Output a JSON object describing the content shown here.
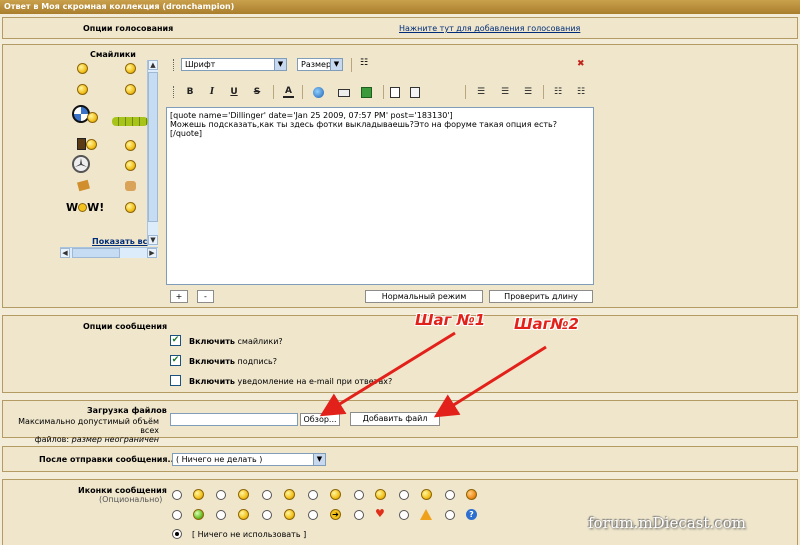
{
  "title": "Ответ в Моя скромная коллекция (dronchampion)",
  "poll": {
    "label": "Опции голосования",
    "link": "Нажните тут для добавления голосования"
  },
  "smilies": {
    "label": "Смайлики",
    "show_all": "Показать вс",
    "items": [
      "smile",
      "sad",
      "grin",
      "cool",
      "bmw",
      "wave",
      "caterpillar",
      "mercedes",
      "laugh",
      "beer",
      "shocked",
      "mercedes-star",
      "thumbsup",
      "cards",
      "thumb",
      "wow",
      "happy"
    ],
    "wow_text": "W",
    "wow_text2": "W!"
  },
  "editor": {
    "font_select": "Шрифт",
    "size_select": "Размер",
    "toolbar": {
      "bold": "B",
      "italic": "I",
      "underline": "U",
      "strike": "S",
      "color": "A",
      "close": "✖"
    },
    "content": "[quote name='Dillinger' date='Jan 25 2009, 07:57 PM' post='183130']\nМожешь подсказать,как ты здесь фотки выкладываешь?Это на форуме такая опция есть?\n[/quote]",
    "plus": "+",
    "minus": "-",
    "normal_mode": "Нормальный режим",
    "check_length": "Проверить длину"
  },
  "message_options": {
    "label": "Опции сообщения",
    "options": [
      {
        "bold": "Включить",
        "rest": " смайлики?",
        "checked": true
      },
      {
        "bold": "Включить",
        "rest": " подпись?",
        "checked": true
      },
      {
        "bold": "Включить",
        "rest": " уведомление на e-mail при ответах?",
        "checked": false
      }
    ],
    "check_mark": "✔"
  },
  "annotations": {
    "step1": "Шаг №1",
    "step2": "Шаг№2",
    "color": "#e2211a"
  },
  "upload": {
    "label": "Загрузка файлов",
    "hint_line1": "Максимально допустимый объём всех",
    "hint_line2_prefix": "файлов: ",
    "hint_line2_value": "размер неограничен",
    "browse": "Обзор...",
    "add_file": "Добавить файл"
  },
  "after_post": {
    "label": "После отправки сообщения...",
    "selected": "( Ничего не делать )"
  },
  "post_icons": {
    "label": "Иконки сообщения",
    "sublabel": "(Опционально)",
    "none": "[ Ничего не использовать ]"
  },
  "watermark": "forum.mDiecast.com"
}
